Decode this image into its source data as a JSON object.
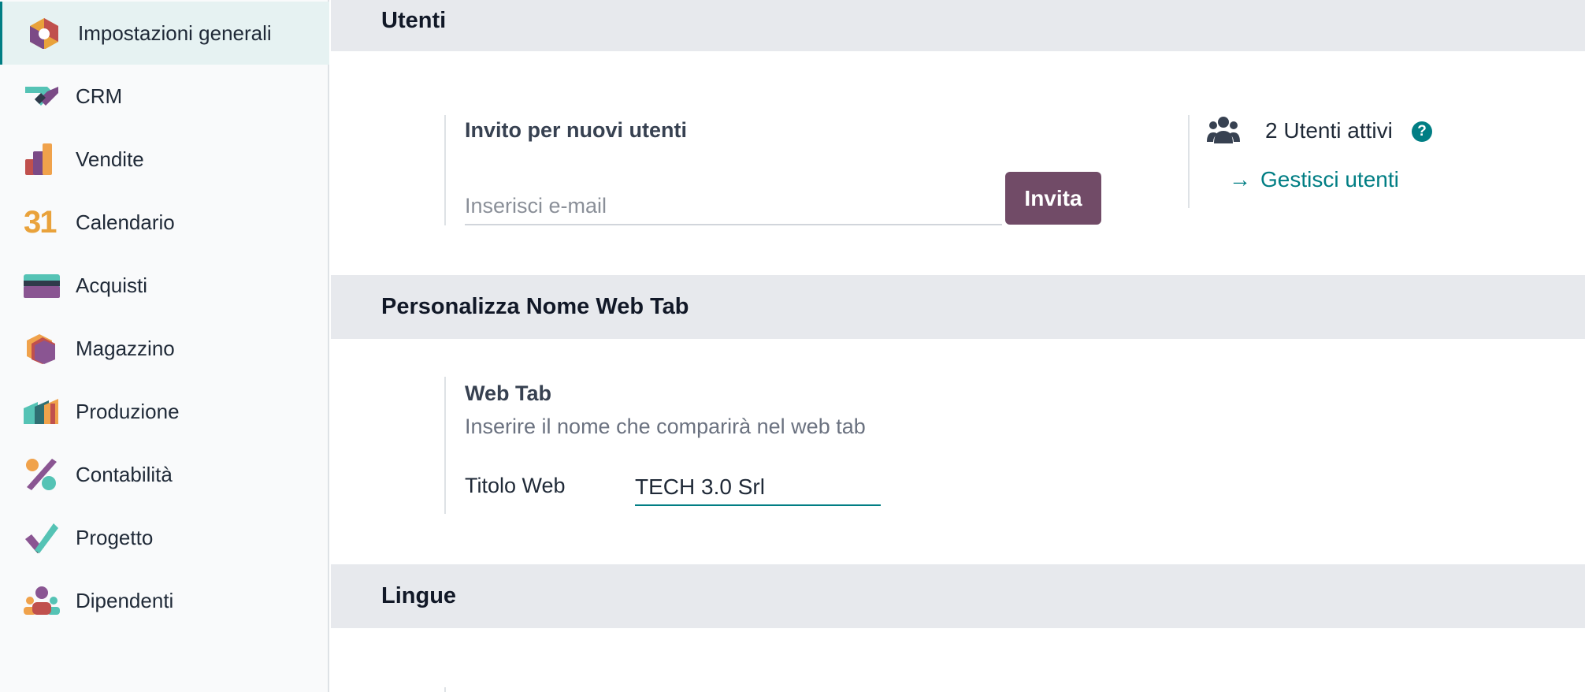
{
  "sidebar": {
    "items": [
      {
        "label": "Impostazioni generali",
        "active": true
      },
      {
        "label": "CRM"
      },
      {
        "label": "Vendite"
      },
      {
        "label": "Calendario"
      },
      {
        "label": "Acquisti"
      },
      {
        "label": "Magazzino"
      },
      {
        "label": "Produzione"
      },
      {
        "label": "Contabilità"
      },
      {
        "label": "Progetto"
      },
      {
        "label": "Dipendenti"
      }
    ],
    "calendar_icon_text": "31"
  },
  "sections": {
    "users": {
      "title": "Utenti",
      "invite_title": "Invito per nuovi utenti",
      "email_placeholder": "Inserisci e-mail",
      "email_value": "",
      "invite_button": "Invita",
      "active_users": "2 Utenti attivi",
      "help_icon_text": "?",
      "manage_users": "Gestisci utenti"
    },
    "webtab": {
      "title": "Personalizza Nome Web Tab",
      "setting_title": "Web Tab",
      "description": "Inserire il nome che comparirà nel web tab",
      "field_label": "Titolo Web",
      "field_value": "TECH 3.0 Srl"
    },
    "languages": {
      "title": "Lingue"
    }
  },
  "colors": {
    "brand_purple": "#714b67",
    "accent_teal": "#017e84",
    "section_bg": "#e7e9ed",
    "sidebar_active_bg": "#e6f2f2"
  },
  "icons": {
    "general_settings": "settings-hexagon-icon",
    "crm": "crm-handshake-icon",
    "sales": "sales-chart-icon",
    "calendar": "calendar-icon",
    "purchase": "purchase-card-icon",
    "inventory": "inventory-box-icon",
    "manufacturing": "manufacturing-factory-icon",
    "accounting": "accounting-percent-icon",
    "project": "project-check-icon",
    "employees": "employees-people-icon",
    "users": "users-group-icon",
    "help": "help-circle-icon",
    "arrow": "arrow-right-icon"
  }
}
